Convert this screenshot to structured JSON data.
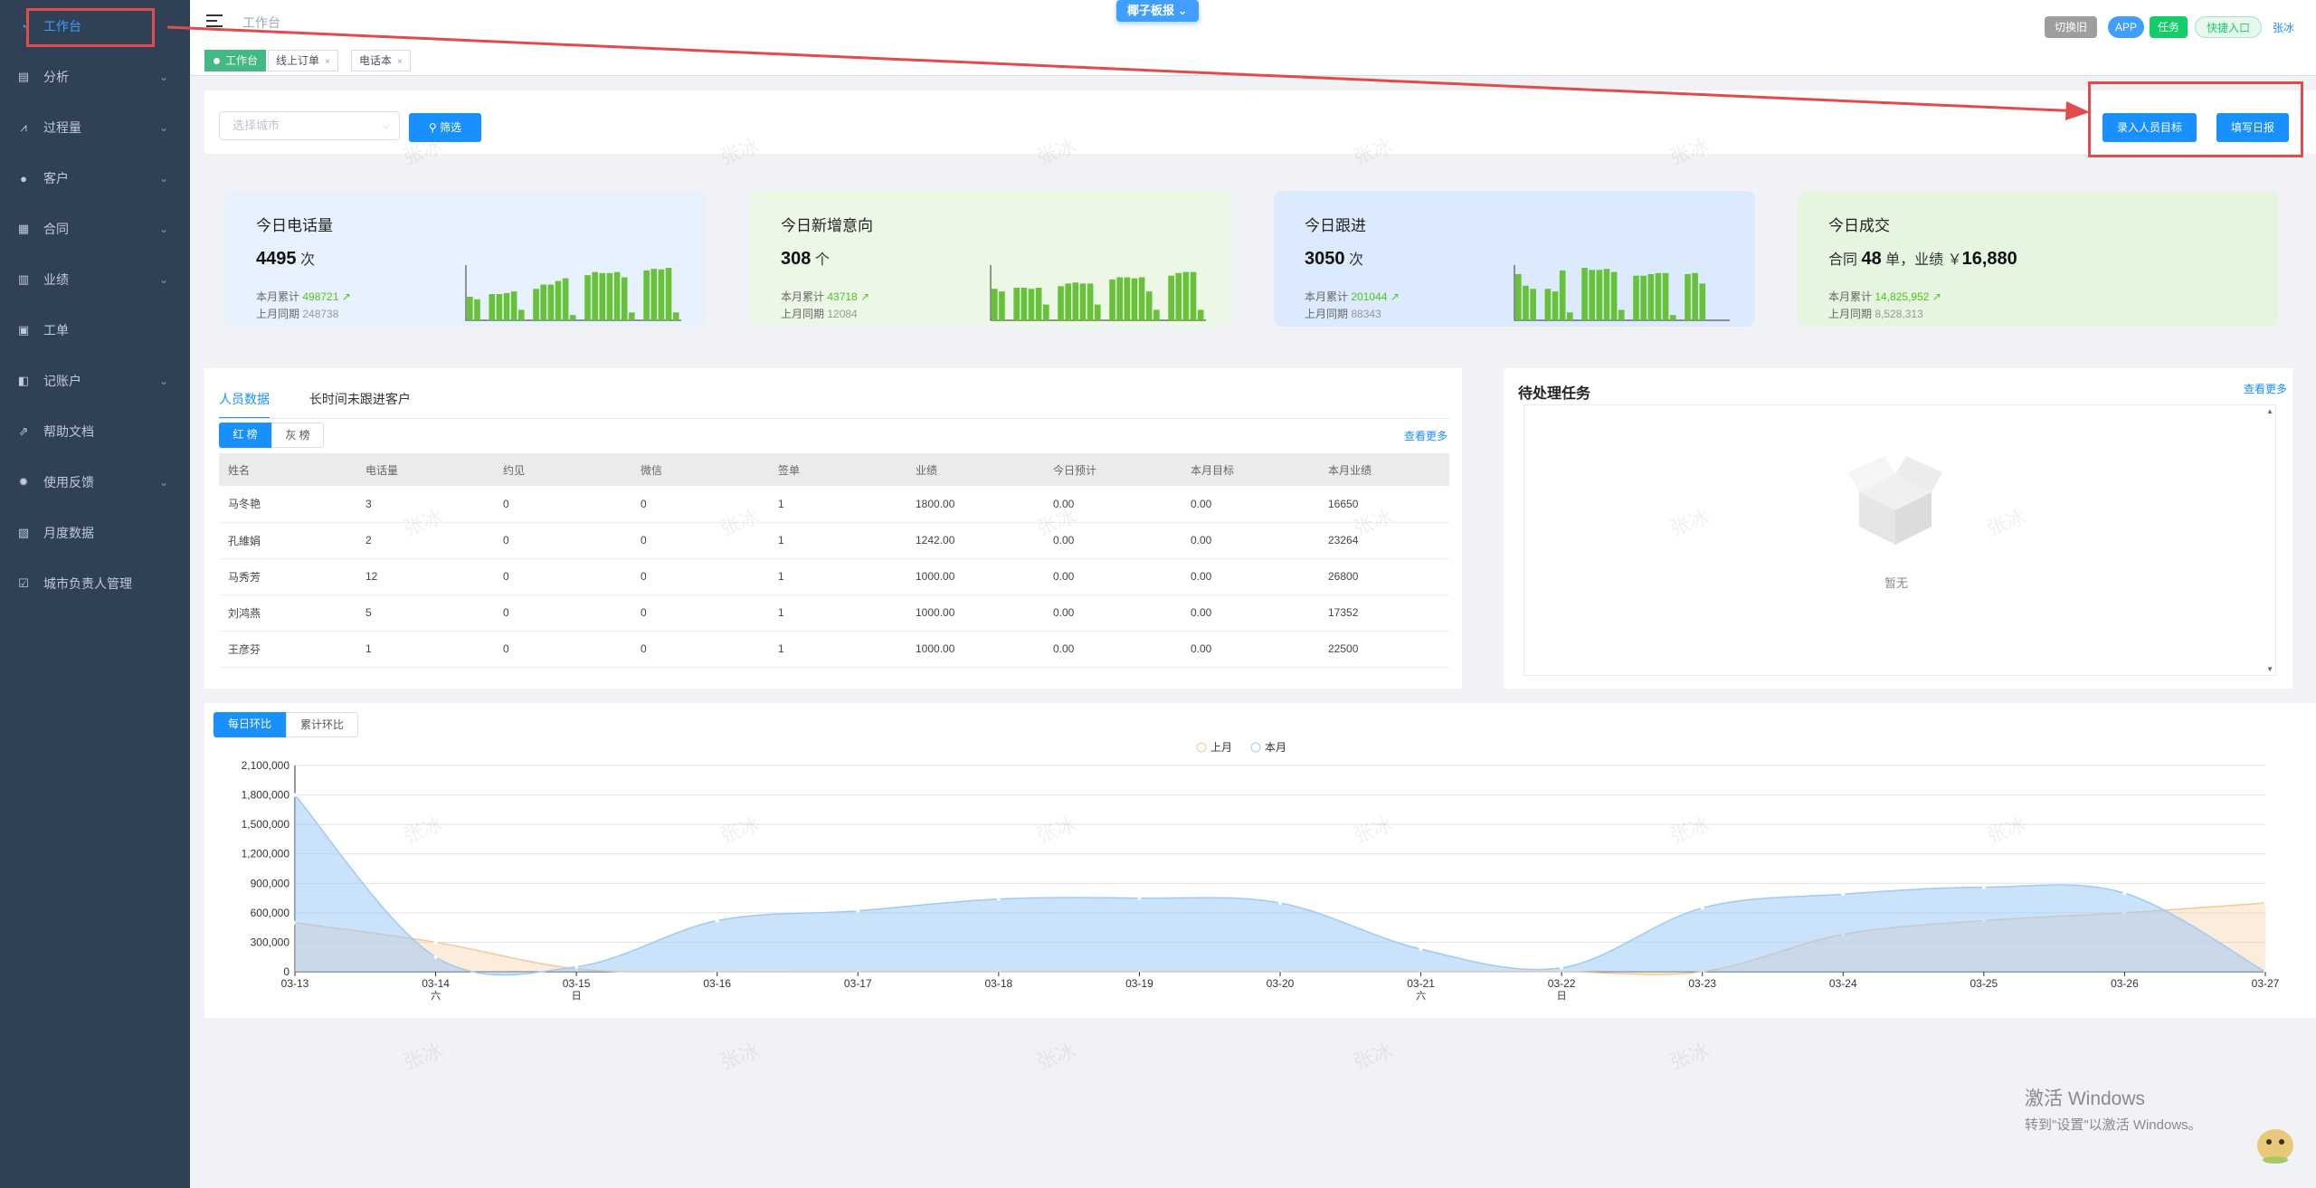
{
  "sidebar": {
    "items": [
      {
        "label": "工作台",
        "icon": "dashboard-icon",
        "active": true
      },
      {
        "label": "分析",
        "icon": "analysis-icon",
        "chevron": true
      },
      {
        "label": "过程量",
        "icon": "chart-line-icon",
        "chevron": true
      },
      {
        "label": "客户",
        "icon": "user-icon",
        "chevron": true
      },
      {
        "label": "合同",
        "icon": "document-icon",
        "chevron": true
      },
      {
        "label": "业绩",
        "icon": "bar-chart-icon",
        "chevron": true
      },
      {
        "label": "工单",
        "icon": "clipboard-icon",
        "chevron": false
      },
      {
        "label": "记账户",
        "icon": "book-icon",
        "chevron": true
      },
      {
        "label": "帮助文档",
        "icon": "external-link-icon",
        "chevron": false
      },
      {
        "label": "使用反馈",
        "icon": "bug-icon",
        "chevron": true
      },
      {
        "label": "月度数据",
        "icon": "report-icon",
        "chevron": false
      },
      {
        "label": "城市负责人管理",
        "icon": "checkbox-icon",
        "chevron": false
      }
    ]
  },
  "header": {
    "breadcrumb": "工作台",
    "dropdown": "椰子板报",
    "switch_old": "切换旧版",
    "app": "APP",
    "task": "任务",
    "quick_entry": "快捷入口",
    "user": "张冰"
  },
  "tags": [
    {
      "label": "工作台",
      "active": true
    },
    {
      "label": "线上订单",
      "active": false
    },
    {
      "label": "电话本",
      "active": false
    }
  ],
  "filter": {
    "city_placeholder": "选择城市",
    "filter_button": "筛选",
    "enter_target_button": "录入人员目标",
    "daily_report_button": "填写日报"
  },
  "cards": [
    {
      "title": "今日电话量",
      "value": "4495",
      "unit": "次",
      "month_label": "本月累计",
      "month_value": "498721",
      "last_label": "上月同期",
      "last_value": "248738",
      "bg": "#e8f2ff",
      "bars": [
        0.45,
        0.4,
        0,
        0.5,
        0.5,
        0.52,
        0.55,
        0.2,
        0,
        0.6,
        0.68,
        0.68,
        0.75,
        0.8,
        0.1,
        0,
        0.86,
        0.92,
        0.9,
        0.9,
        0.92,
        0.82,
        0.15,
        0,
        0.95,
        0.98,
        0.97,
        1,
        0.15
      ]
    },
    {
      "title": "今日新增意向",
      "value": "308",
      "unit": "个",
      "month_label": "本月累计",
      "month_value": "43718",
      "last_label": "上月同期",
      "last_value": "12084",
      "bg": "#edf7e6",
      "bars": [
        0.6,
        0.55,
        0,
        0.62,
        0.62,
        0.6,
        0.62,
        0.3,
        0,
        0.65,
        0.7,
        0.72,
        0.7,
        0.7,
        0.3,
        0,
        0.78,
        0.82,
        0.82,
        0.8,
        0.82,
        0.55,
        0.2,
        0,
        0.85,
        0.9,
        0.92,
        0.92,
        0.2
      ]
    },
    {
      "title": "今日跟进",
      "value": "3050",
      "unit": "次",
      "month_label": "本月累计",
      "month_value": "201044",
      "last_label": "上月同期",
      "last_value": "88343",
      "bg": "#dbeafd",
      "bars": [
        0.88,
        0.66,
        0.6,
        0,
        0.6,
        0.55,
        0.95,
        0.15,
        0,
        1,
        0.96,
        0.96,
        0.98,
        0.92,
        0.2,
        0,
        0.85,
        0.85,
        0.88,
        0.9,
        0.9,
        0.1,
        0,
        0.88,
        0.9,
        0.7,
        0,
        0,
        0
      ]
    },
    {
      "title": "今日成交",
      "value_text": "合同 48 单，业绩 ￥16,880",
      "prefix": "合同",
      "contracts": "48",
      "mid": "单，业绩 ￥",
      "amount": "16,880",
      "month_label": "本月累计",
      "month_value": "14,825,952",
      "last_label": "上月同期",
      "last_value": "8,528,313",
      "bg": "#e5f5e0"
    }
  ],
  "staff_panel": {
    "tab1": "人员数据",
    "tab2": "长时间未跟进客户",
    "rank_red": "红 榜",
    "rank_grey": "灰 榜",
    "more": "查看更多",
    "columns": [
      "姓名",
      "电话量",
      "约见",
      "微信",
      "签单",
      "业绩",
      "今日预计",
      "本月目标",
      "本月业绩"
    ],
    "rows": [
      [
        "马冬艳",
        "3",
        "0",
        "0",
        "1",
        "1800.00",
        "0.00",
        "0.00",
        "16650"
      ],
      [
        "孔維娟",
        "2",
        "0",
        "0",
        "1",
        "1242.00",
        "0.00",
        "0.00",
        "23264"
      ],
      [
        "马秀芳",
        "12",
        "0",
        "0",
        "1",
        "1000.00",
        "0.00",
        "0.00",
        "26800"
      ],
      [
        "刘鸿燕",
        "5",
        "0",
        "0",
        "1",
        "1000.00",
        "0.00",
        "0.00",
        "17352"
      ],
      [
        "王彦芬",
        "1",
        "0",
        "0",
        "1",
        "1000.00",
        "0.00",
        "0.00",
        "22500"
      ]
    ]
  },
  "task_panel": {
    "title": "待处理任务",
    "more": "查看更多",
    "empty": "暂无"
  },
  "chart_panel": {
    "tab_daily": "每日环比",
    "tab_cumulative": "累计环比"
  },
  "chart_data": {
    "type": "area",
    "legend": [
      "上月",
      "本月"
    ],
    "x": [
      "03-13",
      "03-14",
      "03-15",
      "03-16",
      "03-17",
      "03-18",
      "03-19",
      "03-20",
      "03-21",
      "03-22",
      "03-23",
      "03-24",
      "03-25",
      "03-26",
      "03-27"
    ],
    "x_sub": [
      "",
      "六",
      "日",
      "",
      "",
      "",
      "",
      "",
      "六",
      "日",
      "",
      "",
      "",
      "",
      ""
    ],
    "yticks": [
      "0",
      "300,000",
      "600,000",
      "900,000",
      "1,200,000",
      "1,500,000",
      "1,800,000",
      "2,100,000"
    ],
    "ylim": [
      0,
      2100000
    ],
    "series": [
      {
        "name": "上月",
        "color": "#f5c89a",
        "values": [
          500000,
          300000,
          30000,
          0,
          0,
          0,
          0,
          0,
          0,
          0,
          0,
          380000,
          520000,
          600000,
          700000
        ]
      },
      {
        "name": "本月",
        "color": "#9ecbf5",
        "values": [
          1800000,
          150000,
          50000,
          520000,
          620000,
          740000,
          750000,
          700000,
          230000,
          40000,
          650000,
          790000,
          860000,
          800000,
          0
        ]
      }
    ]
  },
  "watermark": "张冰",
  "windows_activation": {
    "line1": "激活 Windows",
    "line2": "转到\"设置\"以激活 Windows。"
  }
}
